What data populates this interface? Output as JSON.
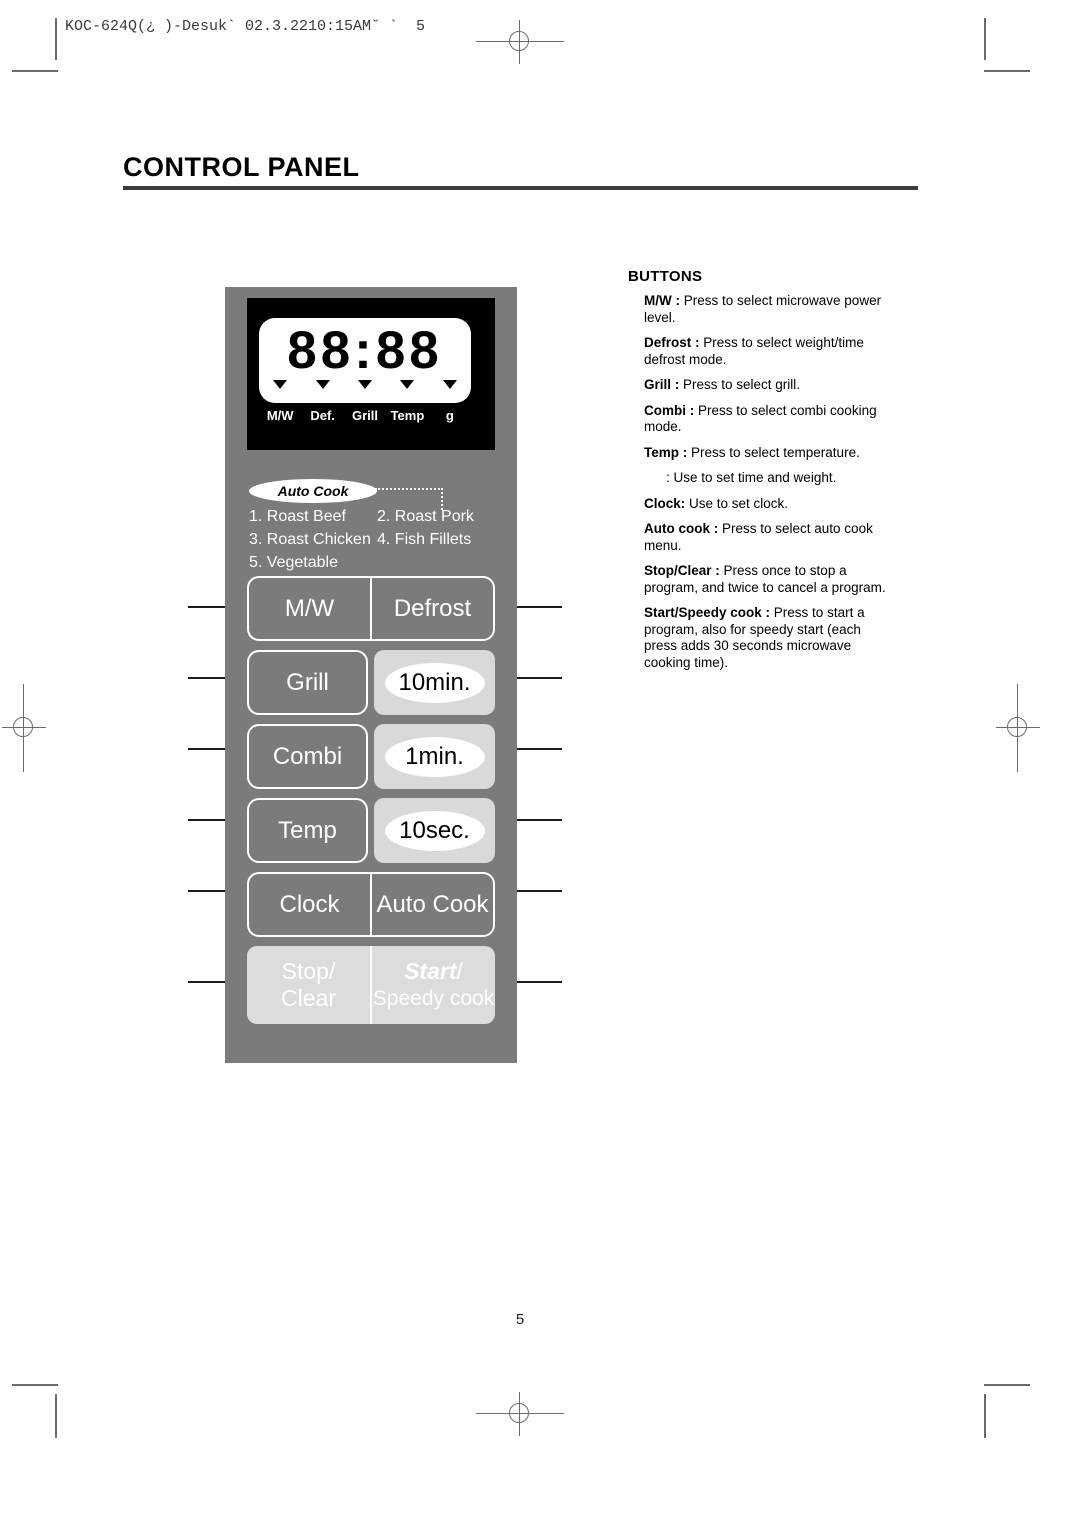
{
  "print_marks": {
    "header_code": "KOC-624Q(¿ )-Desuk` 02.3.2210:15AM˘ `  5"
  },
  "page": {
    "title": "CONTROL PANEL",
    "number": "5"
  },
  "control_panel": {
    "display": {
      "digits": "88:88",
      "indicator_labels": [
        "M/W",
        "Def.",
        "Grill",
        "Temp",
        "g"
      ],
      "indicator_icon": "triangle-down-icon"
    },
    "auto_cook": {
      "badge_label": "Auto Cook",
      "menu": [
        {
          "left": "1. Roast Beef",
          "right": "2. Roast Pork"
        },
        {
          "left": "3. Roast Chicken",
          "right": "4. Fish Fillets"
        },
        {
          "left": "5. Vegetable",
          "right": ""
        }
      ]
    },
    "buttons": {
      "mw": "M/W",
      "defrost": "Defrost",
      "grill": "Grill",
      "ten_min": "10min.",
      "combi": "Combi",
      "one_min": "1min.",
      "temp": "Temp",
      "ten_sec": "10sec.",
      "clock": "Clock",
      "auto_cook": "Auto Cook",
      "stop_line1": "Stop/",
      "stop_line2": "Clear",
      "start_line1": "Start",
      "start_slash": "/",
      "start_line2": "Speedy cook"
    }
  },
  "buttons_section": {
    "heading": "BUTTONS",
    "items": [
      {
        "term": "M/W :",
        "text": " Press to select microwave power level."
      },
      {
        "term": "Defrost :",
        "text": " Press to select weight/time defrost mode."
      },
      {
        "term": "Grill :",
        "text": " Press to select grill."
      },
      {
        "term": "Combi :",
        "text": " Press to select combi cooking mode."
      },
      {
        "term": "Temp :",
        "text": " Press to select temperature."
      },
      {
        "term": "",
        "text": ": Use to set time and weight."
      },
      {
        "term": "Clock:",
        "text": " Use to set clock."
      },
      {
        "term": "Auto cook :",
        "text": " Press to select auto cook menu."
      },
      {
        "term": "Stop/Clear :",
        "text": " Press once to stop a program, and twice to cancel a program."
      },
      {
        "term": "Start/Speedy cook :",
        "text": " Press to start a program, also for speedy start (each press adds 30 seconds microwave cooking time)."
      }
    ]
  },
  "colors": {
    "panel_bg": "#7b7b7b",
    "display_bg": "#000000",
    "lcd_bg": "#ffffff",
    "time_button_bg": "#d9d9d9",
    "bottom_button_bg": "#dcdcdc",
    "rule": "#3c3c3c"
  }
}
